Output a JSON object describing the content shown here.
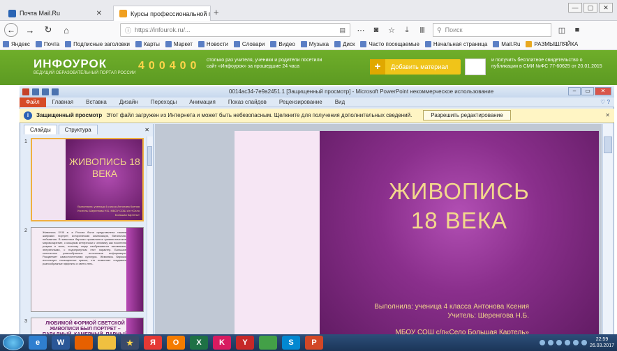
{
  "browser": {
    "tabs": [
      {
        "label": "Почта Mail.Ru",
        "close": "✕",
        "color": "#2a64b4"
      },
      {
        "label": "Курсы профессиональной пе",
        "close": "✕",
        "color": "#f0a020"
      }
    ],
    "new_tab": "+",
    "url": "https://infourok.ru/...",
    "search_placeholder": "Поиск",
    "win_controls": [
      "—",
      "▢",
      "✕"
    ]
  },
  "bookmarks": [
    "Яндекс",
    "Почта",
    "Подписные заголовки",
    "Карты",
    "Маркет",
    "Новости",
    "Словари",
    "Видео",
    "Музыка",
    "Диск",
    "Часто посещаемые",
    "Начальная страница",
    "Mail.Ru",
    "РАЗМЫШЛЯЙКА"
  ],
  "banner": {
    "logo": "ИНФОУРОК",
    "logo_sub": "ВЕДУЩИЙ ОБРАЗОВАТЕЛЬНЫЙ ПОРТАЛ РОССИИ",
    "counter": [
      "4",
      "0",
      "0",
      "4",
      "0",
      "0"
    ],
    "counter_text": "столько раз учителя, ученики и родители посетили сайт «Инфоурок» за прошедшие 24 часа",
    "add_button": "Добавить материал",
    "add_plus": "+",
    "cert_text": "и получить бесплатное свидетельство о публикации в СМИ №ФС 77-60625 от 20.01.2015"
  },
  "ppt": {
    "title": "0014ac34-7e9a2451.1 [Защищенный просмотр] - Microsoft PowerPoint некоммерческое использование",
    "ribbon_file": "Файл",
    "ribbon_tabs": [
      "Главная",
      "Вставка",
      "Дизайн",
      "Переходы",
      "Анимация",
      "Показ слайдов",
      "Рецензирование",
      "Вид"
    ],
    "protected_label": "Защищенный просмотр",
    "protected_text": "Этот файл загружен из Интернета и может быть небезопасным. Щелкните для получения дополнительных сведений.",
    "edit_button": "Разрешить редактирование",
    "panel_tabs": [
      "Слайды",
      "Структура"
    ],
    "slide_numbers": [
      "1",
      "2",
      "3"
    ],
    "thumb1_title": "ЖИВОПИСЬ 18 ВЕКА",
    "thumb1_sub": "Выполнила: ученица 4 класса Антонова Ксения Учитель: Шеренгова Н.Б. МБОУ СОШ с/п «Село Большая Картель»",
    "thumb2_text": "Живопись XVIII в. в России была представлена такими жанрами: портрет, историческая композиция, батальная, пейзажная. В живописи барокко проявляется гуманистическое мировоззрение, с мощным интересом к человеку как носителю разума и воли, поэтому люди изображаются активными, энергичными, с подчеркнутым этот характер. Большое количество разнообразных источников информации. Расцветает самостоятельная культура. Живопись барокко использует насыщенные краски, что позволяет создавать разнообразные эффекты и свето-тень.",
    "thumb3_text": "ЛЮБИМОЙ ФОРМОЙ СВЕТСКОЙ ЖИВОПИСИ БЫЛ ПОРТРЕТ – ПАРАДНЫЙ, КАМЕРНЫЙ, ПАРНЫЙ",
    "slide_title_1": "ЖИВОПИСЬ",
    "slide_title_2": "18 ВЕКА",
    "slide_line_1": "Выполнила: ученица 4 класса Антонова Ксения",
    "slide_line_2": "Учитель: Шеренгова Н.Б.",
    "slide_line_3": "МБОУ СОШ с/п«Село Большая Картель»"
  },
  "taskbar": {
    "apps": [
      "e",
      "W",
      "",
      "",
      "★",
      "Я",
      "O",
      "X",
      "K",
      "Y",
      "",
      "S",
      "P"
    ],
    "clock_time": "22:59",
    "clock_date": "26.03.2017"
  }
}
